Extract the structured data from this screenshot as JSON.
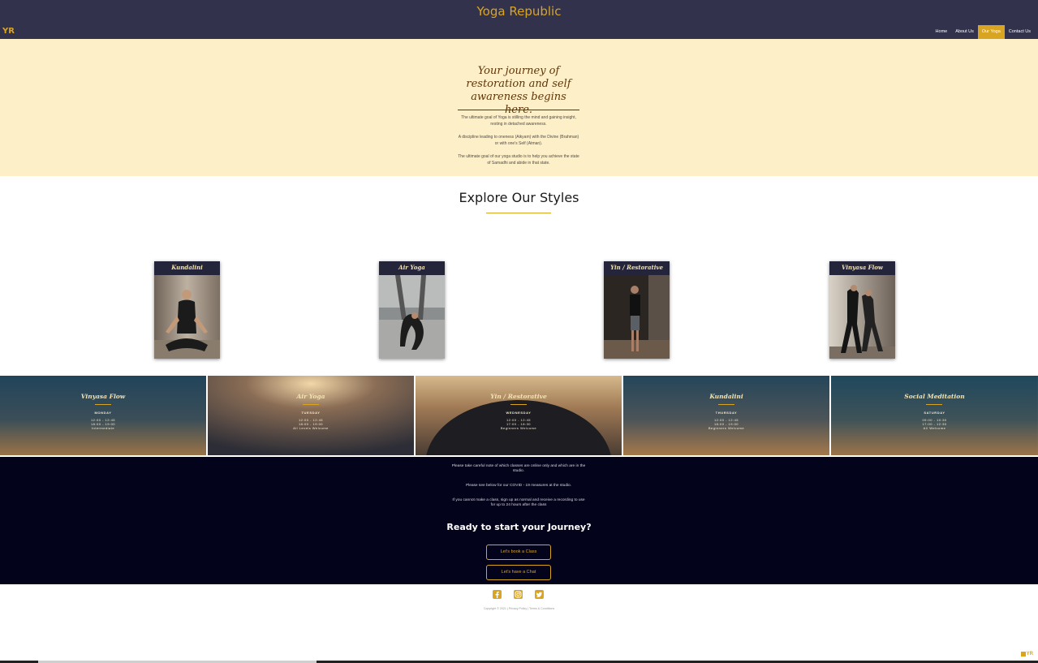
{
  "header": {
    "site_title": "Yoga Republic",
    "logo": "YR",
    "nav": [
      "Home",
      "About Us",
      "Our Yoga",
      "Contact Us"
    ],
    "active_nav": "Our Yoga"
  },
  "hero": {
    "title": "Your journey of restoration and self awareness begins here.",
    "paragraphs": [
      "The ultimate goal of Yoga is stilling the mind and gaining insight, resting in detached awareness.",
      "A discipline leading to oneness (Aikyam) with the Divine (Brahman) or with one's Self (Atman).",
      "The ultimate goal of our yoga studio is to help you achieve the state of Samadhi and abide in that state."
    ]
  },
  "explore": {
    "title": "Explore Our Styles",
    "cards": [
      "Kundalini",
      "Air Yoga",
      "Yin / Restorative",
      "Vinyasa Flow"
    ]
  },
  "schedule": [
    {
      "title": "Vinyasa Flow",
      "day": "MONDAY",
      "lines": [
        "12:00 - 12:45",
        "18:00 - 19:00",
        "Intermediate"
      ]
    },
    {
      "title": "Air Yoga",
      "day": "TUESDAY",
      "lines": [
        "12:00 - 12:45",
        "18:00 - 19:00",
        "All Levels Welcome"
      ]
    },
    {
      "title": "Yin / Restorative",
      "day": "WEDNESDAY",
      "lines": [
        "12:00 - 12:45",
        "17:00 - 18:30",
        "Beginners Welcome"
      ]
    },
    {
      "title": "Kundalini",
      "day": "THURSDAY",
      "lines": [
        "12:00 - 12:45",
        "18:00 - 19:00",
        "Beginners Welcome"
      ]
    },
    {
      "title": "Social Meditation",
      "day": "SATURDAY",
      "lines": [
        "09:00 - 10:30",
        "17:00 - 12:30",
        "All Welcome"
      ]
    }
  ],
  "info": {
    "paragraphs": [
      "Please take careful note of which classes are online only and which are in the studio.",
      "Please see below for our COVID - 19 measures at the studio.",
      "If you cannot make a class, sign up as normal and receive a recording to use for up to 24 hours after the class"
    ],
    "heading": "Ready to start your Journey?",
    "buttons": [
      "Let's book a Class",
      "Let's have a Chat"
    ]
  },
  "footer": {
    "social": [
      "facebook-icon",
      "instagram-icon",
      "twitter-icon"
    ],
    "copyright": "Copyright © 2021 | Privacy Policy | Terms & Conditions",
    "mini_logo": "YR"
  },
  "colors": {
    "header_bg": "#33324c",
    "accent": "#d9a521",
    "hero_bg": "#fdefc8",
    "info_bg": "#04031c"
  }
}
